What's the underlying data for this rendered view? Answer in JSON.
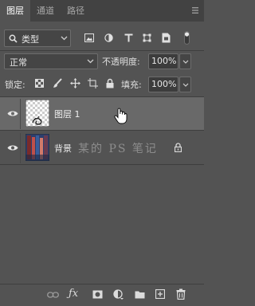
{
  "tabs": [
    {
      "label": "图层",
      "active": true
    },
    {
      "label": "通道",
      "active": false
    },
    {
      "label": "路径",
      "active": false
    }
  ],
  "filter": {
    "label": "类型",
    "icon": "search-icon"
  },
  "filter_icons": [
    "image-filter-icon",
    "adjustment-filter-icon",
    "type-filter-icon",
    "shape-filter-icon",
    "smart-object-filter-icon",
    "toggle-filter-icon"
  ],
  "blend_mode": {
    "value": "正常"
  },
  "opacity": {
    "label": "不透明度:",
    "value": "100%"
  },
  "lock": {
    "label": "锁定:"
  },
  "fill": {
    "label": "填充:",
    "value": "100%"
  },
  "layers": [
    {
      "name": "图层 1",
      "selected": true,
      "visible": true,
      "locked": false
    },
    {
      "name": "背景",
      "selected": false,
      "visible": true,
      "locked": true
    }
  ],
  "watermark": "某的 PS 笔记",
  "colors": {
    "panel": "#535353",
    "selected": "#696969",
    "tabbar": "#424242"
  }
}
